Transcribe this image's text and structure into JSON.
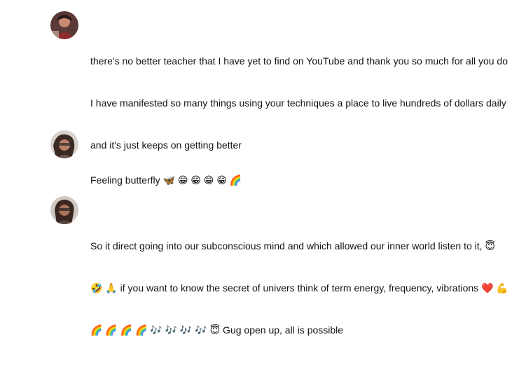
{
  "comments": [
    {
      "avatar_icon": "user-avatar",
      "lines": [
        "there's no better teacher that I have yet to find on YouTube and  thank you so much for all you do",
        "I have manifested so many things using your techniques a place to live hundreds of dollars daily",
        "and it's just keeps on getting better"
      ]
    },
    {
      "avatar_icon": "user-avatar",
      "lines": [
        "Feeling butterfly 🦋  😁 😁 😁 😁 🌈"
      ]
    },
    {
      "avatar_icon": "user-avatar",
      "lines": [
        "So it direct going into our subconscious mind  and which allowed our inner world listen to it, 😇",
        "🤣 🙏  if you want to know the secret of univers think of term energy, frequency, vibrations ❤️ 💪",
        "🌈 🌈 🌈 🌈 🎶 🎶 🎶 🎶 😇 Gug open up, all is possible"
      ]
    }
  ]
}
